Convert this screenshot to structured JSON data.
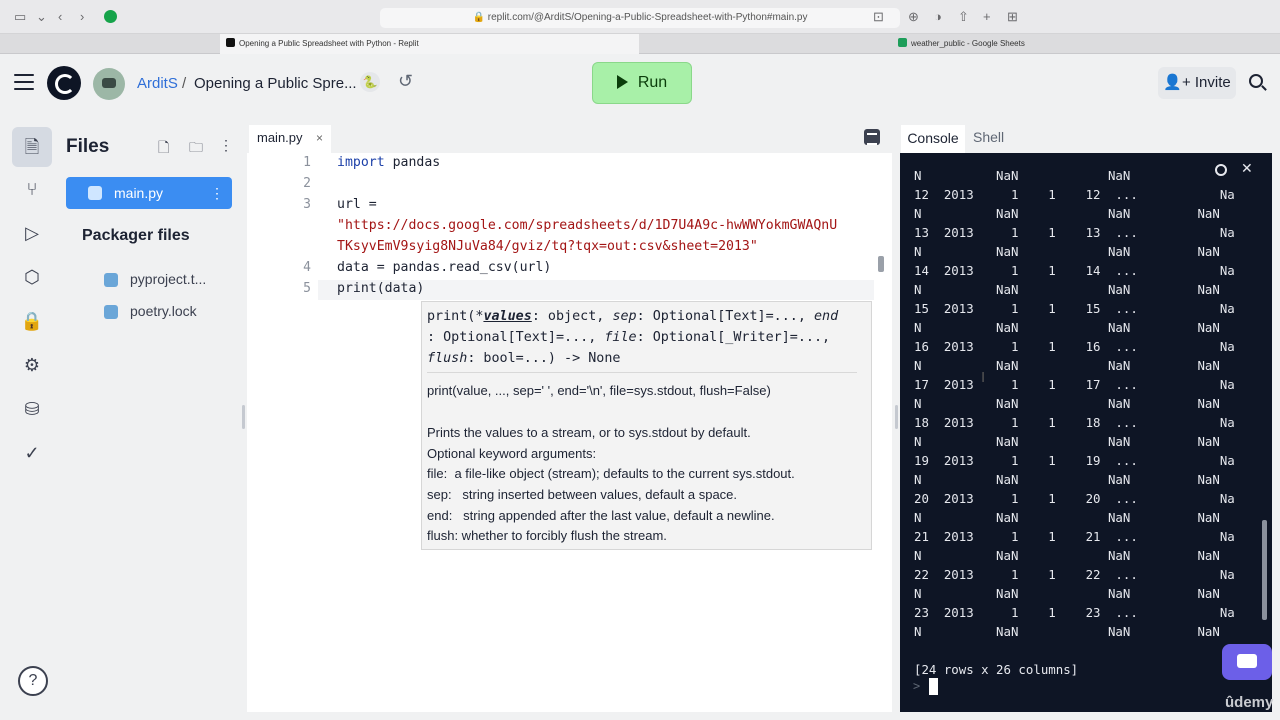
{
  "browser": {
    "url": "replit.com/@ArditS/Opening-a-Public-Spreadsheet-with-Python#main.py",
    "tabs": [
      {
        "label": "Opening a Public Spreadsheet with Python - Replit"
      },
      {
        "label": "weather_public - Google Sheets"
      }
    ]
  },
  "header": {
    "user": "ArditS",
    "separator": "/",
    "repl_title": "Opening a Public Spre...",
    "run_label": "Run",
    "invite_label": "Invite"
  },
  "files": {
    "title": "Files",
    "items": [
      {
        "label": "main.py"
      }
    ],
    "packager_title": "Packager files",
    "packager_items": [
      {
        "label": "pyproject.t..."
      },
      {
        "label": "poetry.lock"
      }
    ]
  },
  "editor": {
    "tab_label": "main.py",
    "line_numbers": [
      "1",
      "2",
      "3",
      "4",
      "5"
    ],
    "code": {
      "l1_kw": "import",
      "l1_rest": " pandas",
      "l3": "url =",
      "l3_str1": "\"https://docs.google.com/spreadsheets/d/1D7U4A9c-hwWWYokmGWAQnU",
      "l3_str2": "TKsyvEmV9syig8NJuVa84/gviz/tq?tqx=out:csv&sheet=2013\"",
      "l4": "data = pandas.read_csv(url)",
      "l5": "print(data)"
    },
    "tooltip": {
      "sig_prefix": "print(*",
      "sig_param": "values",
      "sig_rest1": ": object, ",
      "sig_sep": "sep",
      "sig_rest2": ": Optional[Text]=..., ",
      "sig_end": "end",
      "sig_line2_a": ": Optional[Text]=..., ",
      "sig_file": "file",
      "sig_line2_b": ": Optional[_Writer]=...,",
      "sig_flush": "flush",
      "sig_line3": ": bool=...) -> None",
      "doc_lines": [
        "print(value, ..., sep=' ', end='\\n', file=sys.stdout, flush=False)",
        "Prints the values to a stream, or to sys.stdout by default.",
        "Optional keyword arguments:",
        "file:  a file-like object (stream); defaults to the current sys.stdout.",
        "sep:   string inserted between values, default a space.",
        "end:   string appended after the last value, default a newline.",
        "flush: whether to forcibly flush the stream."
      ]
    }
  },
  "console": {
    "tab_console": "Console",
    "tab_shell": "Shell",
    "output": "N          NaN            NaN            N\n12  2013     1    1    12  ...           Na\nN          NaN            NaN         NaN\n13  2013     1    1    13  ...           Na\nN          NaN            NaN         NaN\n14  2013     1    1    14  ...           Na\nN          NaN            NaN         NaN\n15  2013     1    1    15  ...           Na\nN          NaN            NaN         NaN\n16  2013     1    1    16  ...           Na\nN          NaN            NaN         NaN\n17  2013     1    1    17  ...           Na\nN          NaN            NaN         NaN\n18  2013     1    1    18  ...           Na\nN          NaN            NaN         NaN\n19  2013     1    1    19  ...           Na\nN          NaN            NaN         NaN\n20  2013     1    1    20  ...           Na\nN          NaN            NaN         NaN\n21  2013     1    1    21  ...           Na\nN          NaN            NaN         NaN\n22  2013     1    1    22  ...           Na\nN          NaN            NaN         NaN\n23  2013     1    1    23  ...           Na\nN          NaN            NaN         NaN\n\n[24 rows x 26 columns]",
    "prompt": ">"
  },
  "watermark": "ûdemy",
  "icons": [
    "sidebar-toggle-icon",
    "back-icon",
    "forward-icon",
    "grammarly-icon",
    "shield-icon",
    "share-icon",
    "new-tab-icon",
    "tab-grid-icon",
    "download-icon",
    "hamburger-icon",
    "history-icon",
    "python-icon",
    "new-file-icon",
    "new-folder-icon",
    "kebab-icon",
    "chat-icon"
  ],
  "colors": {
    "run": "#a8f0a8",
    "accent": "#3b8df2",
    "console_bg": "#0e1525",
    "string": "#a31515",
    "keyword": "#1b3fa8"
  }
}
